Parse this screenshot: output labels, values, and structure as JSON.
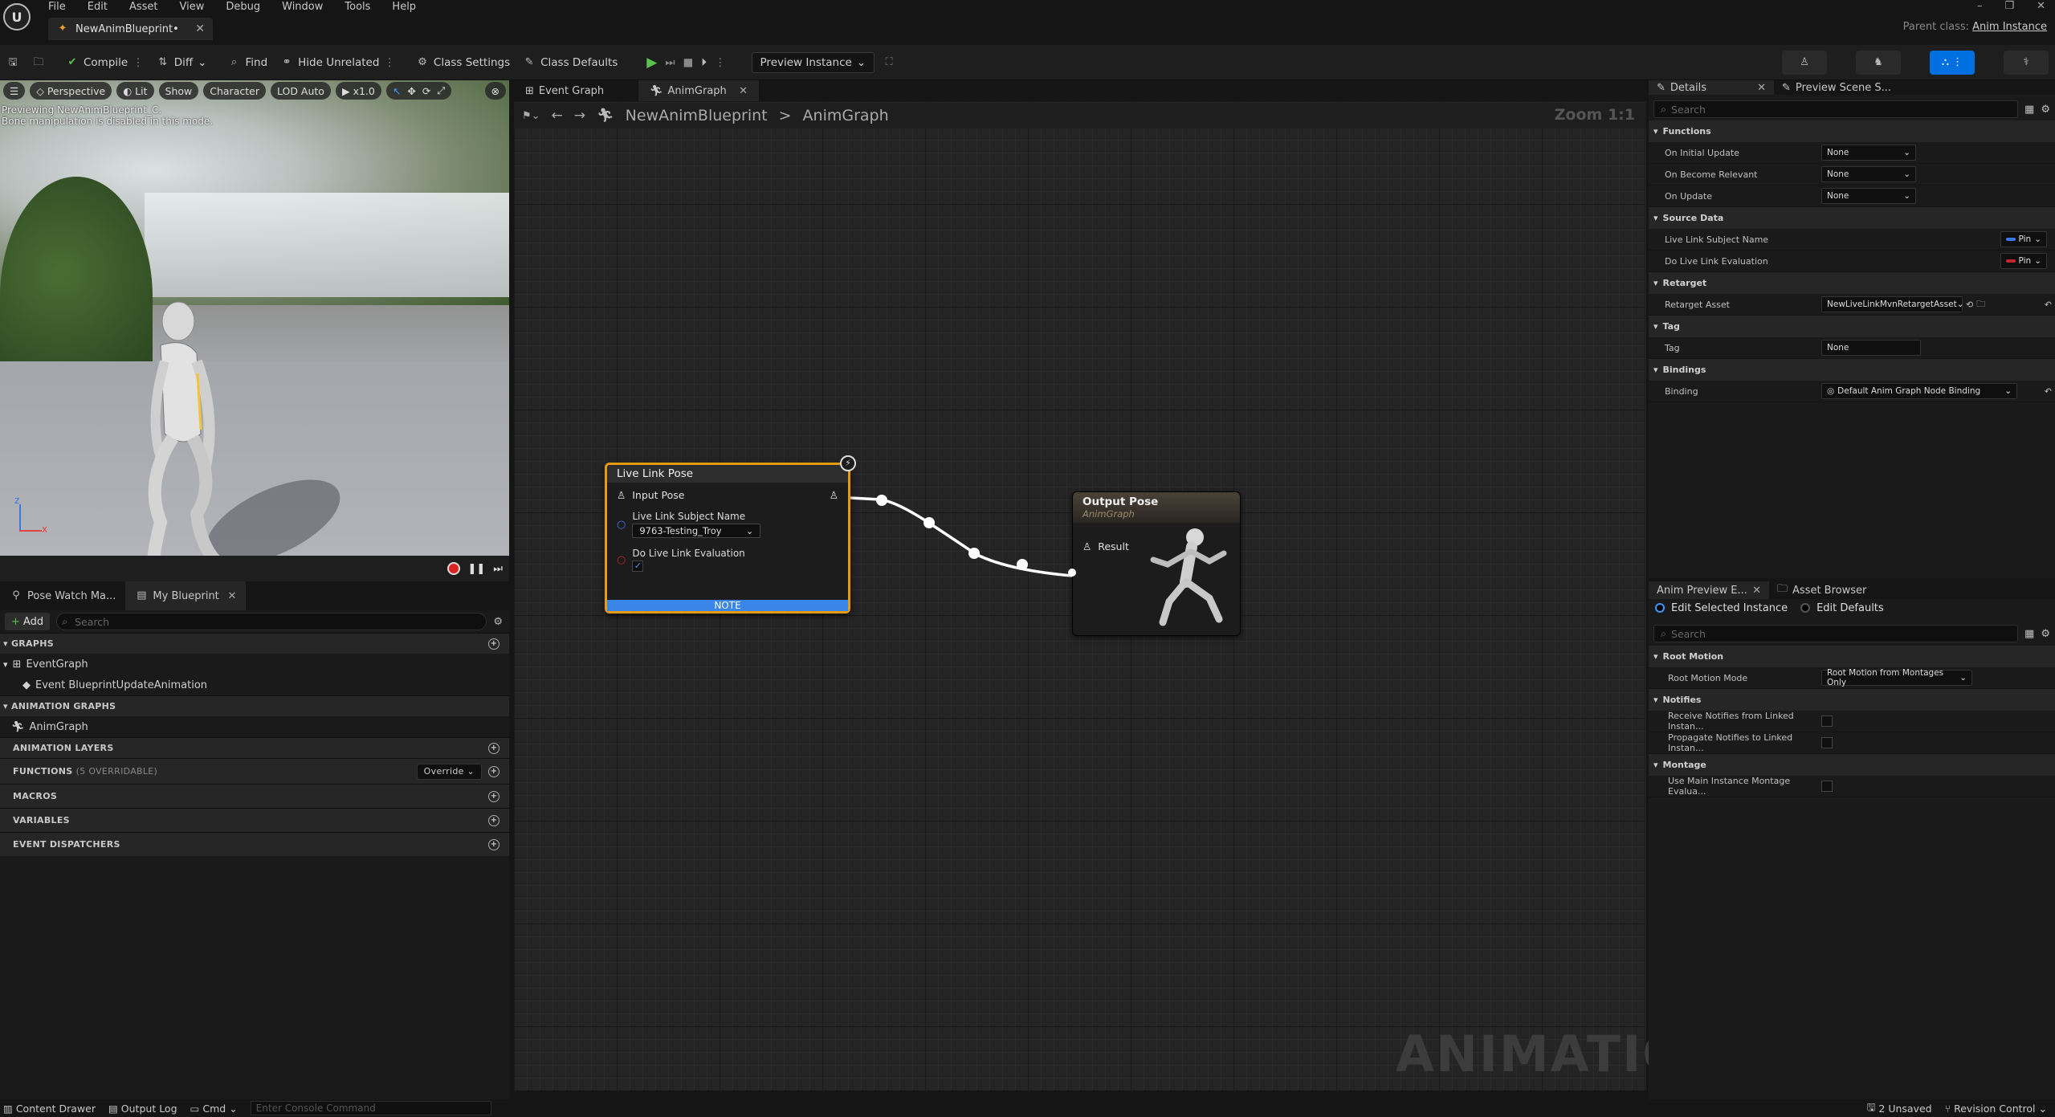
{
  "menu": [
    "File",
    "Edit",
    "Asset",
    "View",
    "Debug",
    "Window",
    "Tools",
    "Help"
  ],
  "doc_tab": {
    "title": "NewAnimBlueprint•"
  },
  "parent_class": {
    "label": "Parent class:",
    "value": "Anim Instance"
  },
  "toolbar": {
    "compile": "Compile",
    "diff": "Diff",
    "find": "Find",
    "hide_unrelated": "Hide Unrelated",
    "class_settings": "Class Settings",
    "class_defaults": "Class Defaults",
    "preview_instance": "Preview Instance"
  },
  "viewport": {
    "perspective": "Perspective",
    "lit": "Lit",
    "show": "Show",
    "character": "Character",
    "lod": "LOD Auto",
    "speed": "x1.0",
    "message_line1": "Previewing NewAnimBlueprint_C.",
    "message_line2": "Bone manipulation is disabled in this mode.",
    "axis_x": "x",
    "axis_z": "z"
  },
  "left_tabs": [
    "Pose Watch Ma...",
    "My Blueprint"
  ],
  "my_blueprint": {
    "add": "Add",
    "search_placeholder": "Search",
    "graphs_header": "GRAPHS",
    "event_graph": "EventGraph",
    "event_update": "Event BlueprintUpdateAnimation",
    "animation_graphs_header": "ANIMATION GRAPHS",
    "anim_graph": "AnimGraph",
    "animation_layers_header": "ANIMATION LAYERS",
    "functions_header": "FUNCTIONS",
    "functions_count": "(5 OVERRIDABLE)",
    "override": "Override",
    "macros_header": "MACROS",
    "variables_header": "VARIABLES",
    "event_dispatchers_header": "EVENT DISPATCHERS"
  },
  "graph_tabs": [
    "Event Graph",
    "AnimGraph"
  ],
  "breadcrumb": {
    "root": "NewAnimBlueprint",
    "sep": ">",
    "leaf": "AnimGraph",
    "zoom": "Zoom 1:1"
  },
  "watermark": "ANIMATION",
  "live_link_node": {
    "title": "Live Link Pose",
    "input_pose": "Input Pose",
    "subject_label": "Live Link Subject Name",
    "subject_value": "9763-Testing_Troy",
    "eval_label": "Do Live Link Evaluation",
    "note": "NOTE"
  },
  "output_node": {
    "title": "Output Pose",
    "subtitle": "AnimGraph",
    "result": "Result"
  },
  "details_tabs": [
    "Details",
    "Preview Scene S..."
  ],
  "details": {
    "search_placeholder": "Search",
    "functions": "Functions",
    "on_initial_update": "On Initial Update",
    "on_become_relevant": "On Become Relevant",
    "on_update": "On Update",
    "none": "None",
    "source_data": "Source Data",
    "subject_name": "Live Link Subject Name",
    "do_eval": "Do Live Link Evaluation",
    "pin": "Pin",
    "retarget": "Retarget",
    "retarget_asset": "Retarget Asset",
    "retarget_value": "NewLiveLinkMvnRetargetAsset",
    "tag_section": "Tag",
    "tag_label": "Tag",
    "tag_value": "None",
    "bindings": "Bindings",
    "binding_label": "Binding",
    "binding_value": "Default Anim Graph Node Binding"
  },
  "anim_preview_tabs": [
    "Anim Preview E...",
    "Asset Browser"
  ],
  "anim_preview": {
    "edit_selected": "Edit Selected Instance",
    "edit_defaults": "Edit Defaults",
    "search_placeholder": "Search",
    "root_motion": "Root Motion",
    "root_motion_mode": "Root Motion Mode",
    "root_motion_value": "Root Motion from Montages Only",
    "notifies": "Notifies",
    "receive_notifies": "Receive Notifies from Linked Instan...",
    "propagate_notifies": "Propagate Notifies to Linked Instan...",
    "montage": "Montage",
    "use_main_montage": "Use Main Instance Montage Evalua..."
  },
  "status": {
    "content_drawer": "Content Drawer",
    "output_log": "Output Log",
    "cmd": "Cmd",
    "console_placeholder": "Enter Console Command",
    "unsaved": "2 Unsaved",
    "revision_control": "Revision Control"
  },
  "colors": {
    "accent": "#0070e0",
    "selection": "#e89a10",
    "pin_blue": "#3a78e8",
    "pin_red": "#c0282a",
    "note": "#3a85e8"
  }
}
